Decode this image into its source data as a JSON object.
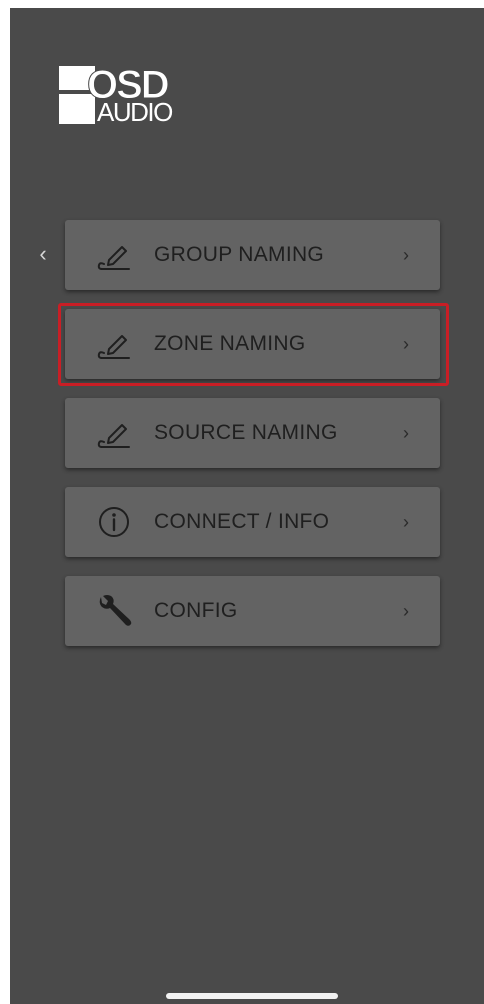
{
  "brand": {
    "logo_text_top": "OSD",
    "logo_text_bottom": "AUDIO"
  },
  "nav": {
    "back_glyph": "‹"
  },
  "menu": {
    "items": [
      {
        "label": "GROUP NAMING",
        "icon": "edit-pencil-icon",
        "chevron": "›"
      },
      {
        "label": "ZONE NAMING",
        "icon": "edit-pencil-icon",
        "chevron": "›",
        "highlighted": true
      },
      {
        "label": "SOURCE NAMING",
        "icon": "edit-pencil-icon",
        "chevron": "›"
      },
      {
        "label": "CONNECT / INFO",
        "icon": "info-circle-icon",
        "chevron": "›"
      },
      {
        "label": "CONFIG",
        "icon": "wrench-icon",
        "chevron": "›"
      }
    ]
  },
  "colors": {
    "background": "#4a4a4a",
    "button": "#636363",
    "text": "#1f1f1f",
    "highlight_border": "#c91e25"
  }
}
